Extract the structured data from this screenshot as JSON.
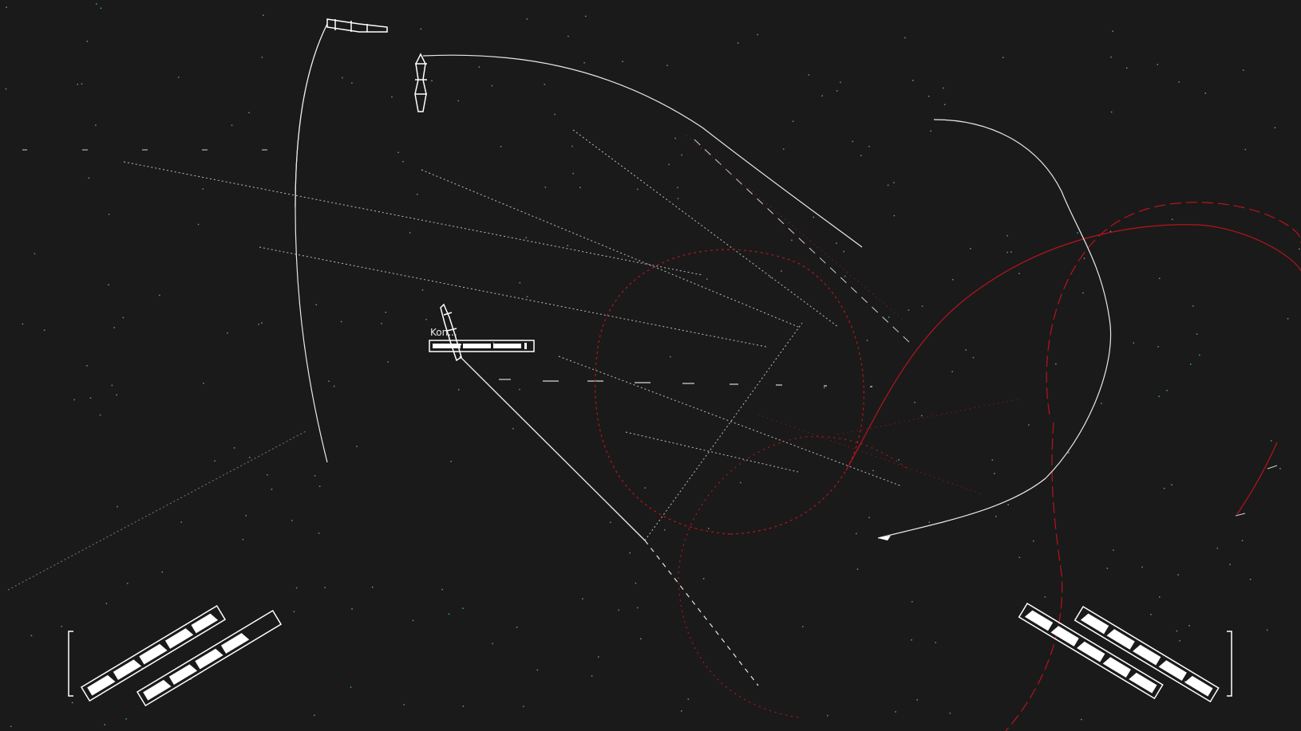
{
  "selected_unit": {
    "name": "Kon...",
    "health": 0.85
  },
  "colors": {
    "background": "#1a1a1a",
    "friendly": "#e8e8e8",
    "enemy": "#b8141c",
    "stars": "#3aa79a"
  },
  "hud": {
    "left_squadron_bars": 2,
    "right_squadron_bars": 2,
    "left_bar_fill": [
      0.9,
      0.75
    ],
    "right_bar_fill": [
      0.85,
      0.9
    ]
  },
  "icons": [
    "ship-icon",
    "health-bar",
    "squadron-bar",
    "orbit-path",
    "weapon-trace"
  ]
}
